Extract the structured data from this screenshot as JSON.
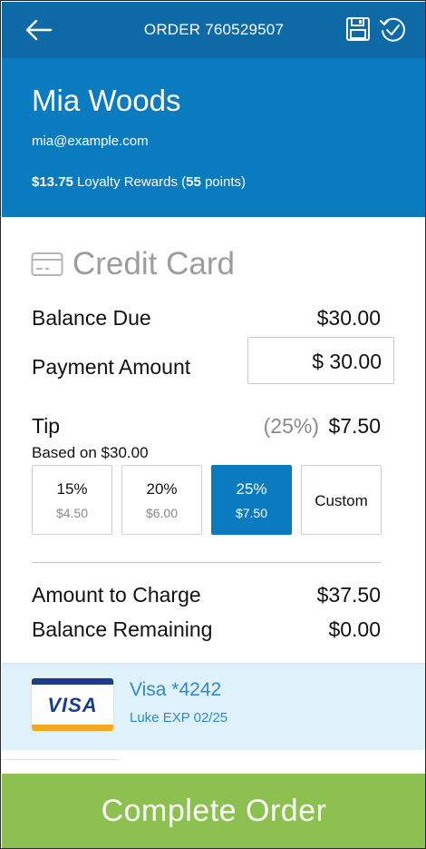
{
  "topbar": {
    "title": "ORDER 760529507",
    "back_icon": "arrow-left-icon",
    "save_icon": "save-icon",
    "history_icon": "history-icon"
  },
  "customer": {
    "name": "Mia Woods",
    "email": "mia@example.com",
    "rewards_amount": "$13.75",
    "rewards_text_1": " Loyalty Rewards (",
    "rewards_points": "55",
    "rewards_text_2": " points)"
  },
  "payment": {
    "method_icon": "credit-card-icon",
    "method_label": "Credit Card",
    "balance_due_label": "Balance Due",
    "balance_due_value": "$30.00",
    "payment_amount_label": "Payment Amount",
    "payment_amount_value": "$ 30.00"
  },
  "tip": {
    "label": "Tip",
    "percent": "(25%)",
    "value": "$7.50",
    "based_on": "Based on $30.00",
    "options": [
      {
        "percent": "15%",
        "amount": "$4.50",
        "selected": false
      },
      {
        "percent": "20%",
        "amount": "$6.00",
        "selected": false
      },
      {
        "percent": "25%",
        "amount": "$7.50",
        "selected": true
      },
      {
        "percent": "Custom",
        "amount": "",
        "selected": false
      }
    ]
  },
  "summary": {
    "charge_label": "Amount to Charge",
    "charge_value": "$37.50",
    "remaining_label": "Balance Remaining",
    "remaining_value": "$0.00"
  },
  "card": {
    "brand_text": "VISA",
    "name": "Visa *4242",
    "holder_exp": "Luke EXP 02/25"
  },
  "actions": {
    "complete_label": "Complete Order"
  },
  "colors": {
    "topbar": "#0d6aa6",
    "header": "#0a7bbf",
    "selected_tip": "#0a7bbf",
    "card_row": "#dff1fb",
    "complete_button": "#8cc152"
  }
}
